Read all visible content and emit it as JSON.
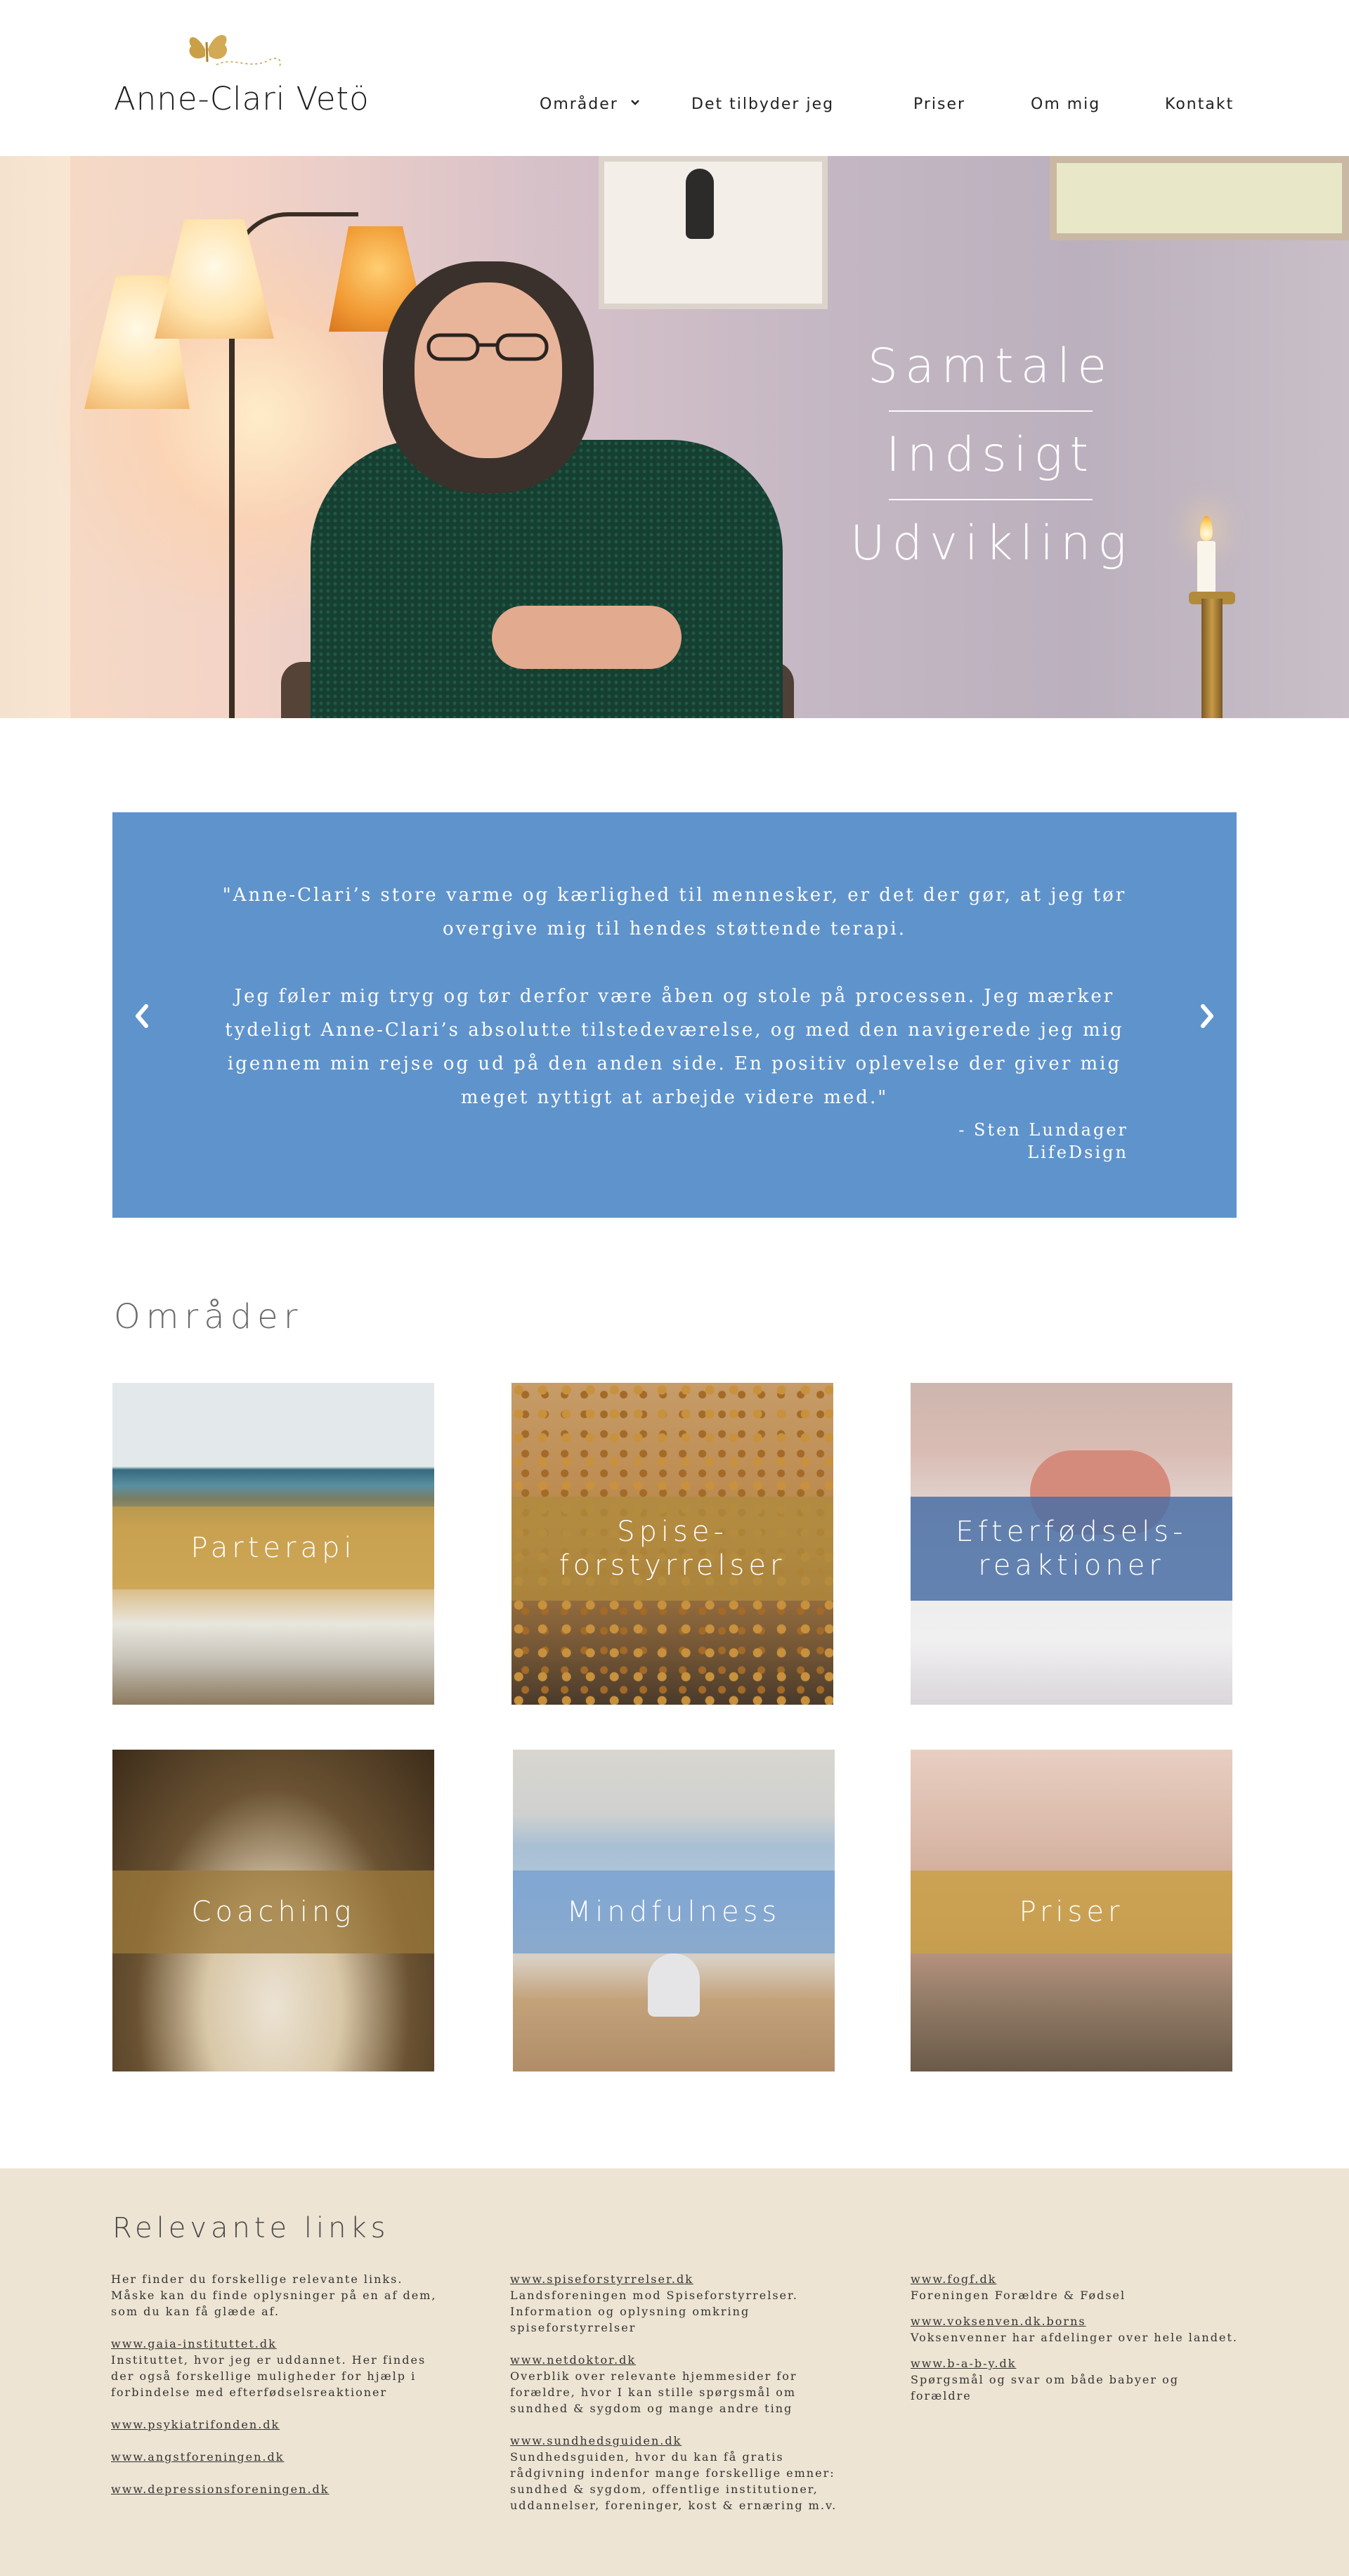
{
  "brand": {
    "name": "Anne-Clari Vetö",
    "accent": "#c9a046"
  },
  "nav": {
    "items": [
      {
        "label": "Områder",
        "has_dropdown": true
      },
      {
        "label": "Det tilbyder jeg"
      },
      {
        "label": "Priser"
      },
      {
        "label": "Om mig"
      },
      {
        "label": "Kontakt"
      }
    ]
  },
  "hero": {
    "words": [
      "Samtale",
      "Indsigt",
      "Udvikling"
    ]
  },
  "testimonial": {
    "background": "#5f93cc",
    "paragraphs": [
      "\"Anne-Clari’s store varme og kærlighed til mennesker, er det der gør, at jeg tør overgive mig til hendes støttende terapi.",
      "Jeg føler mig tryg og tør derfor være åben og stole på processen. Jeg mærker tydeligt Anne-Clari’s absolutte tilstedeværelse, og med den navigerede jeg mig igennem min rejse og ud på den anden side. En positiv oplevelse der giver mig meget nyttigt at arbejde videre med.\""
    ],
    "author": "- Sten Lundager",
    "company": "LifeDsign",
    "prev_icon": "chevron-left-icon",
    "next_icon": "chevron-right-icon"
  },
  "areas": {
    "title": "Områder",
    "tiles": [
      {
        "label": "Parterapi",
        "band_color": "#c9a046"
      },
      {
        "label_lines": [
          "Spise-",
          "forstyrrelser"
        ],
        "band_color": "#b08a3e"
      },
      {
        "label_lines": [
          "Efterfødsels-",
          "reaktioner"
        ],
        "band_color": "#4a6fa5"
      },
      {
        "label": "Coaching",
        "band_color": "#9c7a3a"
      },
      {
        "label": "Mindfulness",
        "band_color": "#6f9bd0"
      },
      {
        "label": "Priser",
        "band_color": "#c9a046"
      }
    ]
  },
  "footer": {
    "title": "Relevante links",
    "columns": [
      {
        "intro_lines": [
          "Her finder du forskellige relevante links.",
          "Måske kan du finde oplysninger på en af dem,",
          "som du kan få glæde af."
        ],
        "entries": [
          {
            "link": "www.gaia-instituttet.dk",
            "desc_lines": [
              "Instituttet, hvor jeg er uddannet. Her findes",
              "der også forskellige muligheder for hjælp i",
              "forbindelse med efterfødselsreaktioner"
            ]
          },
          {
            "link": "www.psykiatrifonden.dk",
            "desc_lines": []
          },
          {
            "link": "www.angstforeningen.dk",
            "desc_lines": []
          },
          {
            "link": "www.depressionsforeningen.dk",
            "desc_lines": []
          }
        ]
      },
      {
        "entries": [
          {
            "link": "www.spiseforstyrrelser.dk",
            "desc_lines": [
              "Landsforeningen mod Spiseforstyrrelser.",
              "Information og oplysning omkring",
              "spiseforstyrrelser"
            ]
          },
          {
            "link": "www.netdoktor.dk",
            "desc_lines": [
              "Overblik over relevante hjemmesider for",
              "forældre, hvor I kan stille spørgsmål om",
              "sundhed & sygdom og mange andre ting"
            ]
          },
          {
            "link": "www.sundhedsguiden.dk",
            "desc_lines": [
              "Sundhedsguiden, hvor du kan få gratis",
              "rådgivning indenfor mange forskellige emner:",
              "sundhed & sygdom, offentlige institutioner,",
              "uddannelser, foreninger, kost & ernæring m.v."
            ]
          }
        ]
      },
      {
        "entries": [
          {
            "link": "www.fogf.dk",
            "desc_lines": [
              "Foreningen Forældre & Fødsel"
            ]
          },
          {
            "link": "www.voksenven.dk.borns",
            "desc_lines": [
              "Voksenvenner har afdelinger over hele landet."
            ]
          },
          {
            "link": "www.b-a-b-y.dk",
            "desc_lines": [
              "Spørgsmål og svar om både babyer og forældre"
            ]
          }
        ]
      }
    ],
    "background": "#ede4d3"
  }
}
